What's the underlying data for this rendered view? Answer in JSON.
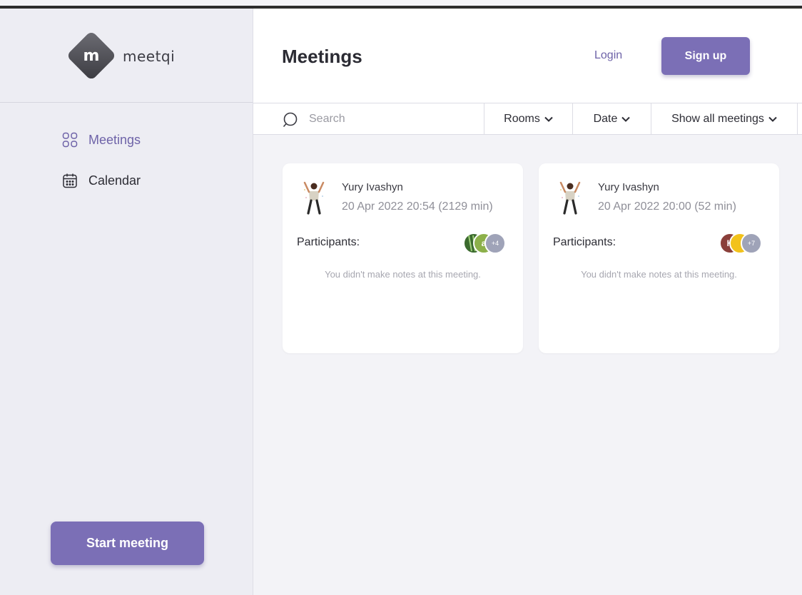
{
  "app": {
    "logo_text": "meetqi",
    "logo_letter": "m"
  },
  "sidebar": {
    "items": [
      {
        "label": "Meetings",
        "icon": "grid-icon",
        "active": true
      },
      {
        "label": "Calendar",
        "icon": "calendar-icon",
        "active": false
      }
    ],
    "start_button_label": "Start meeting"
  },
  "header": {
    "title": "Meetings",
    "login_label": "Login",
    "signup_label": "Sign up"
  },
  "filters": {
    "search_placeholder": "Search",
    "rooms_label": "Rooms",
    "date_label": "Date",
    "show_label": "Show all meetings"
  },
  "meetings": [
    {
      "owner": "Yury Ivashyn",
      "date": "20 Apr 2022 20:54 (2129 min)",
      "participants_label": "Participants:",
      "participant_avatars": [
        {
          "initial": "",
          "color": "#3b6a2e"
        },
        {
          "initial": "a",
          "color": "#8cb04a"
        }
      ],
      "more_count": "+4",
      "notes": "You didn't make notes at this meeting."
    },
    {
      "owner": "Yury Ivashyn",
      "date": "20 Apr 2022 20:00 (52 min)",
      "participants_label": "Participants:",
      "participant_avatars": [
        {
          "initial": "K",
          "color": "#8a3f3a"
        },
        {
          "initial": "",
          "color": "#f2c21b"
        }
      ],
      "more_count": "+7",
      "notes": "You didn't make notes at this meeting."
    }
  ],
  "colors": {
    "accent": "#7b6fb6",
    "accent_text": "#6e63a8",
    "sidebar_bg": "#ededf3",
    "content_bg": "#f3f3f7"
  }
}
